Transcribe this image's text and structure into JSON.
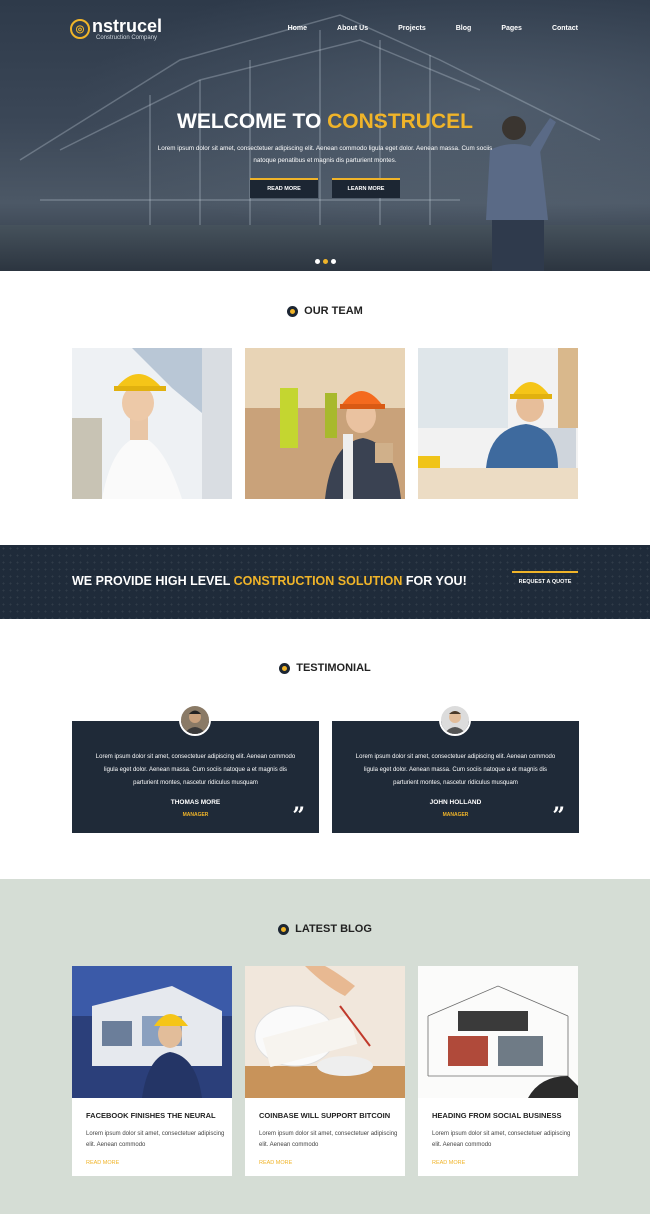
{
  "brand": {
    "name": "nstrucel",
    "tagline": "Construction Company"
  },
  "nav": [
    "Home",
    "About Us",
    "Projects",
    "Blog",
    "Pages",
    "Contact"
  ],
  "hero": {
    "title_prefix": "WELCOME TO",
    "title_highlight": "CONSTRUCEL",
    "text": "Lorem ipsum dolor sit amet, consectetuer adipiscing elit. Aenean commodo ligula eget dolor. Aenean massa. Cum sociis natoque penatibus et magnis dis parturient montes.",
    "buttons": [
      "READ MORE",
      "LEARN MORE"
    ],
    "slides": 3,
    "active_slide": 2
  },
  "team": {
    "heading": "OUR TEAM"
  },
  "banner": {
    "text_start": "WE PROVIDE HIGH LEVEL",
    "text_highlight": "CONSTRUCTION SOLUTION",
    "text_end": "FOR YOU!",
    "button": "REQUEST A QUOTE"
  },
  "testimonial": {
    "heading": "TESTIMONIAL",
    "items": [
      {
        "text": "Lorem ipsum dolor sit amet, consectetuer adipiscing elit. Aenean commodo ligula eget dolor. Aenean massa. Cum sociis natoque a et magnis dis parturient montes, nascetur ridiculus musquam",
        "name": "THOMAS MORE",
        "role": "MANAGER"
      },
      {
        "text": "Lorem ipsum dolor sit amet, consectetuer adipiscing elit. Aenean commodo ligula eget dolor. Aenean massa. Cum sociis natoque a et magnis dis parturient montes, nascetur ridiculus musquam",
        "name": "JOHN HOLLAND",
        "role": "MANAGER"
      }
    ]
  },
  "blog": {
    "heading": "LATEST BLOG",
    "posts": [
      {
        "title": "FACEBOOK FINISHES THE NEURAL",
        "text": "Lorem ipsum dolor sit amet, consectetuer adipiscing elit. Aenean commodo",
        "more": "READ MORE"
      },
      {
        "title": "COINBASE WILL SUPPORT BITCOIN",
        "text": "Lorem ipsum dolor sit amet, consectetuer adipiscing elit. Aenean commodo",
        "more": "READ MORE"
      },
      {
        "title": "HEADING FROM SOCIAL BUSINESS",
        "text": "Lorem ipsum dolor sit amet, consectetuer adipiscing elit. Aenean commodo",
        "more": "READ MORE"
      }
    ]
  },
  "colors": {
    "accent": "#f0b429",
    "dark": "#1f2a38",
    "blog_bg": "#d5ddd5"
  }
}
